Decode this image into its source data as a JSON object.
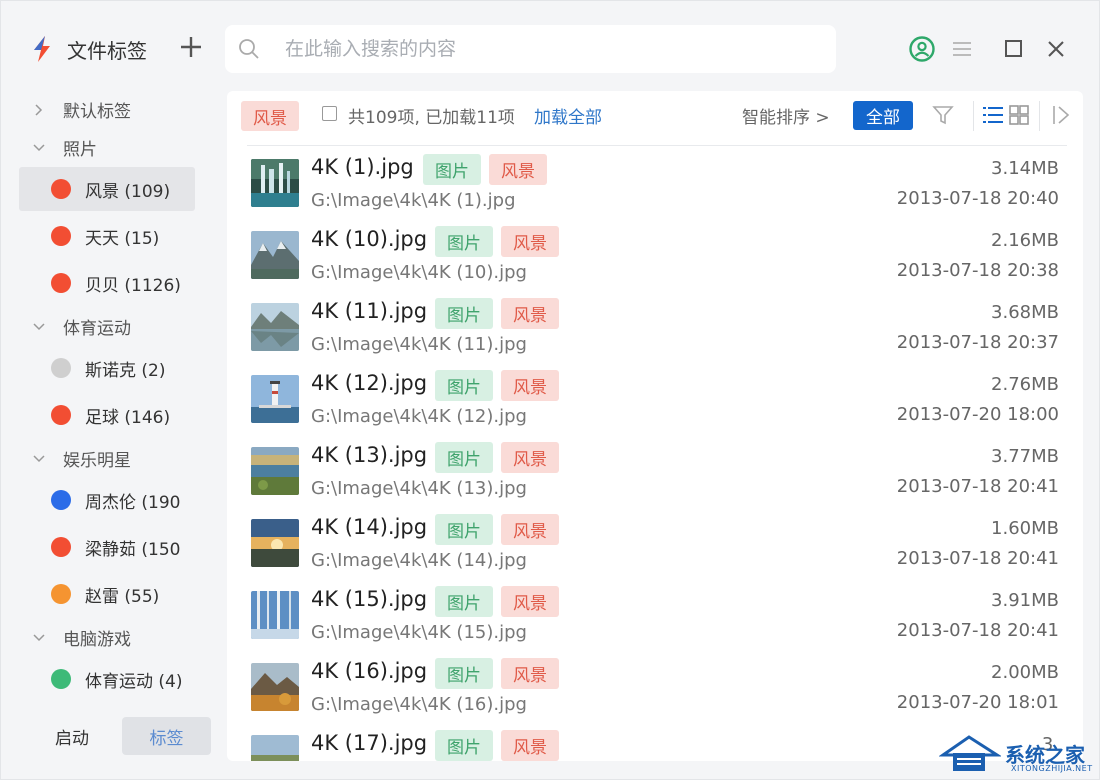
{
  "app": {
    "title": "文件标签",
    "add_icon": "plus-icon"
  },
  "search": {
    "placeholder": "在此输入搜索的内容",
    "value": ""
  },
  "window_controls": [
    "user-icon",
    "menu-icon",
    "maximize-icon",
    "close-icon"
  ],
  "colors": {
    "red_tag": "#f24e33",
    "gray_tag": "#cfcfcf",
    "blue_tag": "#2b6ce8",
    "orange_tag": "#f59431",
    "green_tag": "#3dba78",
    "accent": "#1366cc",
    "green_icon": "#2ea86a"
  },
  "sidebar": {
    "groups": [
      {
        "label": "默认标签",
        "expanded": false,
        "items": []
      },
      {
        "label": "照片",
        "expanded": true,
        "items": [
          {
            "label": "风景 (109)",
            "color": "#f24e33",
            "active": true
          },
          {
            "label": "天天 (15)",
            "color": "#f24e33",
            "active": false
          },
          {
            "label": "贝贝 (1126)",
            "color": "#f24e33",
            "active": false
          }
        ]
      },
      {
        "label": "体育运动",
        "expanded": true,
        "items": [
          {
            "label": "斯诺克 (2)",
            "color": "#cfcfcf",
            "active": false
          },
          {
            "label": "足球 (146)",
            "color": "#f24e33",
            "active": false
          }
        ]
      },
      {
        "label": "娱乐明星",
        "expanded": true,
        "items": [
          {
            "label": "周杰伦 (190",
            "color": "#2b6ce8",
            "active": false
          },
          {
            "label": "梁静茹 (150",
            "color": "#f24e33",
            "active": false
          },
          {
            "label": "赵雷 (55)",
            "color": "#f59431",
            "active": false
          }
        ]
      },
      {
        "label": "电脑游戏",
        "expanded": true,
        "items": [
          {
            "label": "体育运动 (4)",
            "color": "#3dba78",
            "active": false
          }
        ]
      }
    ],
    "bottom_tabs": {
      "launch": "启动",
      "tags": "标签"
    }
  },
  "toolbar": {
    "current_tag": "风景",
    "count_text": "共109项, 已加载11项",
    "load_all": "加载全部",
    "sort": "智能排序 >",
    "all": "全部",
    "icons": [
      "filter-icon",
      "list-view-icon",
      "grid-view-icon",
      "collapse-panel-icon"
    ]
  },
  "files": [
    {
      "name": "4K (1).jpg",
      "tags": [
        "图片",
        "风景"
      ],
      "path": "G:\\Image\\4k\\4K (1).jpg",
      "size": "3.14MB",
      "date": "2013-07-18 20:40",
      "thumb": "waterfall"
    },
    {
      "name": "4K (10).jpg",
      "tags": [
        "图片",
        "风景"
      ],
      "path": "G:\\Image\\4k\\4K (10).jpg",
      "size": "2.16MB",
      "date": "2013-07-18 20:38",
      "thumb": "mountains"
    },
    {
      "name": "4K (11).jpg",
      "tags": [
        "图片",
        "风景"
      ],
      "path": "G:\\Image\\4k\\4K (11).jpg",
      "size": "3.68MB",
      "date": "2013-07-18 20:37",
      "thumb": "lake"
    },
    {
      "name": "4K (12).jpg",
      "tags": [
        "图片",
        "风景"
      ],
      "path": "G:\\Image\\4k\\4K (12).jpg",
      "size": "2.76MB",
      "date": "2013-07-20 18:00",
      "thumb": "lighthouse"
    },
    {
      "name": "4K (13).jpg",
      "tags": [
        "图片",
        "风景"
      ],
      "path": "G:\\Image\\4k\\4K (13).jpg",
      "size": "3.77MB",
      "date": "2013-07-18 20:41",
      "thumb": "coast"
    },
    {
      "name": "4K (14).jpg",
      "tags": [
        "图片",
        "风景"
      ],
      "path": "G:\\Image\\4k\\4K (14).jpg",
      "size": "1.60MB",
      "date": "2013-07-18 20:41",
      "thumb": "sunset"
    },
    {
      "name": "4K (15).jpg",
      "tags": [
        "图片",
        "风景"
      ],
      "path": "G:\\Image\\4k\\4K (15).jpg",
      "size": "3.91MB",
      "date": "2013-07-18 20:41",
      "thumb": "birch"
    },
    {
      "name": "4K (16).jpg",
      "tags": [
        "图片",
        "风景"
      ],
      "path": "G:\\Image\\4k\\4K (16).jpg",
      "size": "2.00MB",
      "date": "2013-07-20 18:01",
      "thumb": "autumn"
    },
    {
      "name": "4K (17).jpg",
      "tags": [
        "图片",
        "风景"
      ],
      "path": "",
      "size": "3.",
      "date": "",
      "thumb": "field"
    }
  ],
  "watermark": {
    "text": "系统之家",
    "sub": "XITONGZHIJIA.NET"
  }
}
